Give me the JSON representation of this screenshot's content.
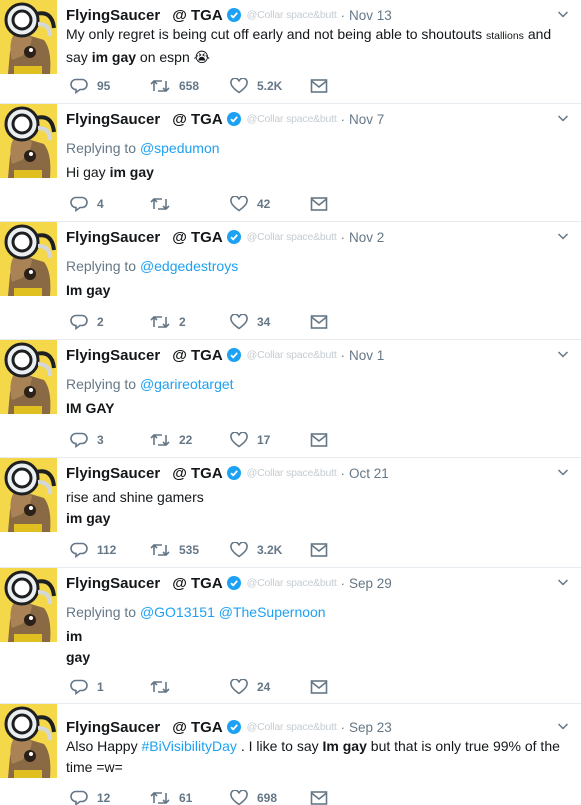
{
  "colors": {
    "link": "#1da1f2",
    "muted": "#657786",
    "verified": "#1da1f2",
    "avatar_bg": "#f4d84a"
  },
  "icons": {
    "reply": "reply-icon",
    "retweet": "retweet-icon",
    "like": "heart-icon",
    "dm": "envelope-icon",
    "verified": "verified-badge-icon",
    "caret": "chevron-down-icon"
  },
  "tweets": [
    {
      "name": "FlyingSaucer",
      "tag": "@ TGA",
      "handle": "@Collar space&butt",
      "date": "Nov 13",
      "text1": "My only regret is being cut off early and not being able to shoutouts ",
      "text_small": "stallions",
      "text2": "  and say ",
      "text_bold": "im gay",
      "text3": " on espn ",
      "emoji": "😭",
      "replies": "95",
      "retweets": "658",
      "likes": "5.2K"
    },
    {
      "name": "FlyingSaucer",
      "tag": "@ TGA",
      "handle": "@Collar space&butt",
      "date": "Nov 7",
      "replying_label": "Replying to ",
      "replying_to": "@spedumon",
      "text1": "Hi gay ",
      "text_bold": "im gay",
      "replies": "4",
      "retweets": "",
      "likes": "42"
    },
    {
      "name": "FlyingSaucer",
      "tag": "@ TGA",
      "handle": "@Collar space&butt",
      "date": "Nov 2",
      "replying_label": "Replying to ",
      "replying_to": "@edgedestroys",
      "text_bold": "Im gay",
      "replies": "2",
      "retweets": "2",
      "likes": "34"
    },
    {
      "name": "FlyingSaucer",
      "tag": "@ TGA",
      "handle": "@Collar space&butt",
      "date": "Nov 1",
      "replying_label": "Replying to ",
      "replying_to": "@garireotarget",
      "text_bold": "IM GAY",
      "replies": "3",
      "retweets": "22",
      "likes": "17"
    },
    {
      "name": "FlyingSaucer",
      "tag": "@ TGA",
      "handle": "@Collar space&butt",
      "date": "Oct 21",
      "text1": "rise and shine gamers",
      "text_bold": "im gay",
      "replies": "112",
      "retweets": "535",
      "likes": "3.2K"
    },
    {
      "name": "FlyingSaucer",
      "tag": "@ TGA",
      "handle": "@Collar space&butt",
      "date": "Sep 29",
      "replying_label": "Replying to ",
      "replying_to": "@GO13151",
      "replying_to2": "@TheSupernoon",
      "text_bold": "im",
      "text_bold2": "gay",
      "replies": "1",
      "retweets": "",
      "likes": "24"
    },
    {
      "name": "FlyingSaucer",
      "tag": "@ TGA",
      "handle": "@Collar space&butt",
      "date": "Sep 23",
      "text1": "Also Happy ",
      "hashtag": "#BiVisibilityDay",
      "text2": " . I like to say ",
      "text_bold": "Im gay",
      "text3": " but that is only true 99% of the time =w=",
      "replies": "12",
      "retweets": "61",
      "likes": "698"
    }
  ]
}
